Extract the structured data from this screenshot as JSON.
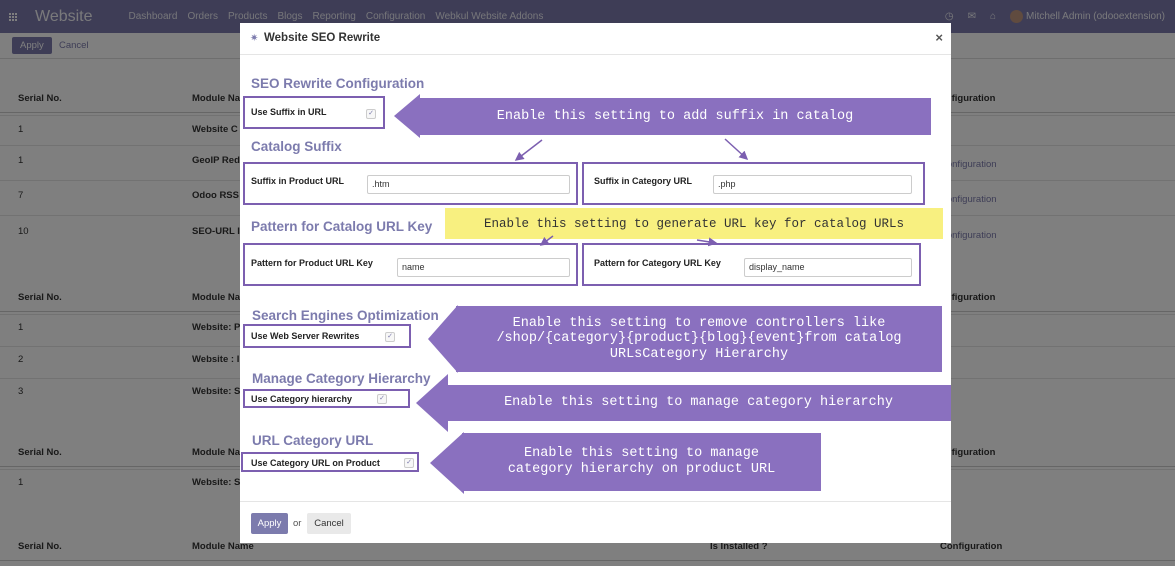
{
  "navbar": {
    "app_name": "Website",
    "menu": [
      "Dashboard",
      "Orders",
      "Products",
      "Blogs",
      "Reporting",
      "Configuration",
      "Webkul Website Addons"
    ],
    "user": "Mitchell Admin (odooextension)"
  },
  "control_panel": {
    "apply": "Apply",
    "cancel": "Cancel"
  },
  "bg_table": {
    "headers": [
      "Serial No.",
      "Module Name",
      "Is Installed ?",
      "Configuration"
    ],
    "header_partial": [
      "Module Na",
      "onfiguration"
    ],
    "groups": [
      {
        "rows": [
          {
            "serial": "1",
            "name": "Website C",
            "config": ""
          },
          {
            "serial": "1",
            "name": "GeoIP Red",
            "config": "Configuration"
          },
          {
            "serial": "7",
            "name": "Odoo RSS",
            "config": "Configuration"
          },
          {
            "serial": "10",
            "name": "SEO-URL I",
            "config": "Configuration"
          }
        ]
      },
      {
        "rows": [
          {
            "serial": "1",
            "name": "Website: P",
            "config": ""
          },
          {
            "serial": "2",
            "name": "Website : I",
            "config": ""
          },
          {
            "serial": "3",
            "name": "Website: S",
            "config": ""
          }
        ]
      },
      {
        "rows": [
          {
            "serial": "1",
            "name": "Website: S",
            "config": ""
          }
        ]
      }
    ]
  },
  "modal": {
    "title": "Website SEO Rewrite",
    "close": "×",
    "sections": {
      "seo_config": "SEO Rewrite Configuration",
      "catalog_suffix": "Catalog Suffix",
      "pattern": "Pattern for Catalog URL Key",
      "search_engines": "Search Engines Optimization",
      "category_hierarchy": "Manage Category Hierarchy",
      "url_category": "URL Category URL"
    },
    "fields": {
      "use_suffix": "Use Suffix in URL",
      "suffix_product_label": "Suffix in Product URL",
      "suffix_product_value": ".htm",
      "suffix_category_label": "Suffix in Category URL",
      "suffix_category_value": ".php",
      "pattern_product_label": "Pattern for Product URL Key",
      "pattern_product_value": "name",
      "pattern_category_label": "Pattern for Category URL Key",
      "pattern_category_value": "display_name",
      "web_server_rewrites": "Use Web Server Rewrites",
      "category_hierarchy": "Use Category hierarchy",
      "category_url_on_product": "Use Category URL on Product"
    },
    "footer": {
      "apply": "Apply",
      "or": "or",
      "cancel": "Cancel"
    }
  },
  "annotations": {
    "suffix": "Enable this setting to add suffix in catalog",
    "url_key": "Enable this setting to generate URL key for catalog URLs",
    "controllers": "Enable this setting to remove controllers like /shop/{category}{product}{blog}{event}from catalog URLsCategory Hierarchy",
    "hierarchy": "Enable this setting to manage category hierarchy",
    "product_url": "Enable this setting to manage category hierarchy on product URL"
  },
  "colors": {
    "brand": "#7c7bad",
    "annotation": "#8a70bf",
    "highlight_border": "#7c5fb0",
    "yellow": "#f8f080"
  }
}
